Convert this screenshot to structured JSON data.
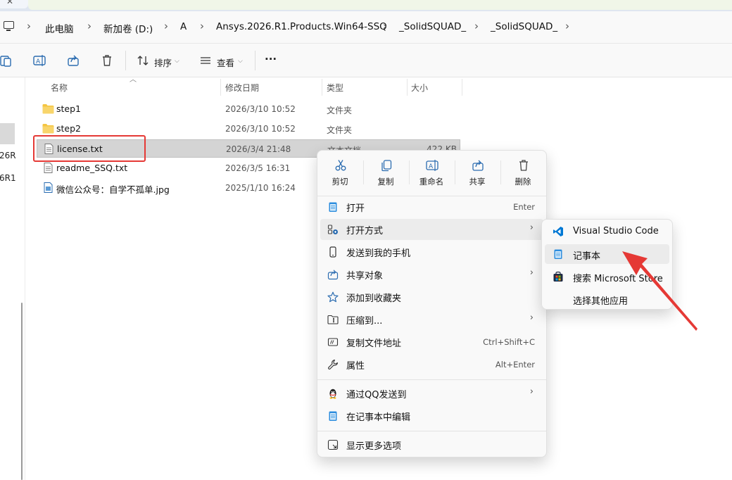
{
  "breadcrumb": [
    "此电脑",
    "新加卷 (D:)",
    "A",
    "Ansys.2026.R1.Products.Win64-SSQ",
    "_SolidSQUAD_",
    "_SolidSQUAD_"
  ],
  "toolbar": {
    "sort_label": "排序",
    "view_label": "查看",
    "more_label": "···"
  },
  "nav": {
    "item1": "26R",
    "item2": "6R1"
  },
  "columns": {
    "name": "名称",
    "modified": "修改日期",
    "type": "类型",
    "size": "大小"
  },
  "files": [
    {
      "name": "step1",
      "date": "2026/3/10 10:52",
      "type": "文件夹",
      "size": ""
    },
    {
      "name": "step2",
      "date": "2026/3/10 10:52",
      "type": "文件夹",
      "size": ""
    },
    {
      "name": "license.txt",
      "date": "2026/3/4 21:48",
      "type": "文本文档",
      "size": "422 KB"
    },
    {
      "name": "readme_SSQ.txt",
      "date": "2026/3/5 16:31",
      "type": "",
      "size": ""
    },
    {
      "name": "微信公众号：自学不孤单.jpg",
      "date": "2025/1/10 16:24",
      "type": "",
      "size": ""
    }
  ],
  "context_menu": {
    "quick_actions": [
      "剪切",
      "复制",
      "重命名",
      "共享",
      "删除"
    ],
    "items": [
      {
        "label": "打开",
        "shortcut": "Enter"
      },
      {
        "label": "打开方式",
        "shortcut": ""
      },
      {
        "label": "发送到我的手机",
        "shortcut": ""
      },
      {
        "label": "共享对象",
        "shortcut": ""
      },
      {
        "label": "添加到收藏夹",
        "shortcut": ""
      },
      {
        "label": "压缩到...",
        "shortcut": ""
      },
      {
        "label": "复制文件地址",
        "shortcut": "Ctrl+Shift+C"
      },
      {
        "label": "属性",
        "shortcut": "Alt+Enter"
      },
      {
        "label": "通过QQ发送到",
        "shortcut": ""
      },
      {
        "label": "在记事本中编辑",
        "shortcut": ""
      },
      {
        "label": "显示更多选项",
        "shortcut": ""
      }
    ]
  },
  "submenu": {
    "items": [
      "Visual Studio Code",
      "记事本",
      "搜索 Microsoft Store",
      "选择其他应用"
    ]
  },
  "colors": {
    "highlight_box": "#e53935",
    "arrow": "#e53935",
    "folder": "#f4c542",
    "vscode": "#0078d4"
  }
}
